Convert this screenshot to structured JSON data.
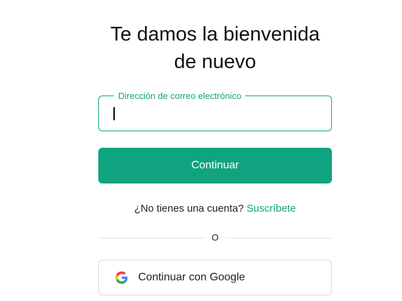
{
  "heading": {
    "line1": "Te damos la bienvenida",
    "line2": "de nuevo"
  },
  "email": {
    "label": "Dirección de correo electrónico",
    "value": ""
  },
  "continue_button": {
    "label": "Continuar"
  },
  "signup": {
    "prompt": "¿No tienes una cuenta?",
    "link_label": "Suscríbete"
  },
  "divider": {
    "label": "O"
  },
  "google_button": {
    "label": "Continuar con Google",
    "icon": "google-icon"
  },
  "colors": {
    "accent": "#10a37f",
    "border": "#d9d9e3",
    "text": "#202123"
  }
}
